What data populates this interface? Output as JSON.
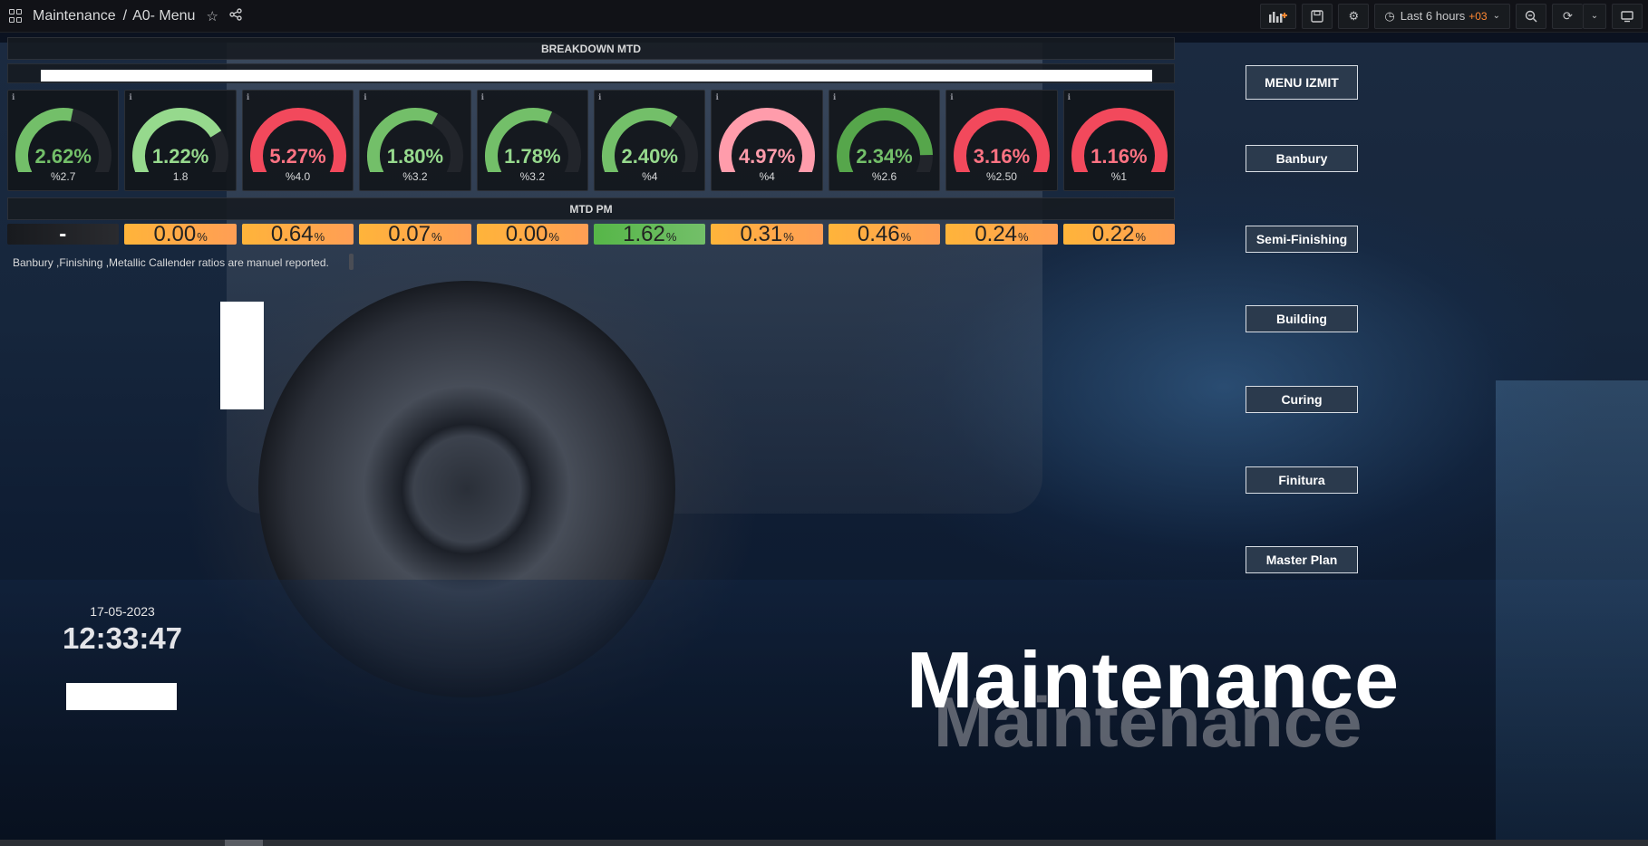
{
  "topbar": {
    "folder": "Maintenance",
    "separator": "/",
    "dashboard": "A0- Menu",
    "time_range": "Last 6 hours",
    "timezone": "+03"
  },
  "rows": {
    "breakdown": "BREAKDOWN MTD",
    "pm": "MTD PM"
  },
  "colors": {
    "green": "#73bf69",
    "dark_green": "#56a64b",
    "red": "#f2495c",
    "light_red": "#ff7383",
    "orange": "#ff9830",
    "track": "#22252b"
  },
  "gauges": [
    {
      "value": "2.62%",
      "label": "%2.7",
      "fill": 0.55,
      "color": "#73bf69",
      "text_color": "#73bf69"
    },
    {
      "value": "1.22%",
      "label": "1.8",
      "fill": 0.75,
      "color": "#96d98d",
      "text_color": "#96d98d"
    },
    {
      "value": "5.27%",
      "label": "%4.0",
      "fill": 1.0,
      "color": "#f2495c",
      "text_color": "#ff7383"
    },
    {
      "value": "1.80%",
      "label": "%3.2",
      "fill": 0.62,
      "color": "#73bf69",
      "text_color": "#96d98d"
    },
    {
      "value": "1.78%",
      "label": "%3.2",
      "fill": 0.6,
      "color": "#73bf69",
      "text_color": "#96d98d"
    },
    {
      "value": "2.40%",
      "label": "%4",
      "fill": 0.65,
      "color": "#73bf69",
      "text_color": "#96d98d"
    },
    {
      "value": "4.97%",
      "label": "%4",
      "fill": 1.0,
      "color": "#ff9cab",
      "text_color": "#ff9cab"
    },
    {
      "value": "2.34%",
      "label": "%2.6",
      "fill": 0.88,
      "color": "#56a64b",
      "text_color": "#73bf69"
    },
    {
      "value": "3.16%",
      "label": "%2.50",
      "fill": 1.0,
      "color": "#f2495c",
      "text_color": "#ff7383"
    },
    {
      "value": "1.16%",
      "label": "%1",
      "fill": 1.0,
      "color": "#f2495c",
      "text_color": "#ff7383"
    }
  ],
  "stats": [
    {
      "value": "-",
      "unit": "",
      "style": "dark"
    },
    {
      "value": "0.00",
      "unit": "%",
      "style": "orange"
    },
    {
      "value": "0.64",
      "unit": "%",
      "style": "orange"
    },
    {
      "value": "0.07",
      "unit": "%",
      "style": "orange"
    },
    {
      "value": "0.00",
      "unit": "%",
      "style": "orange"
    },
    {
      "value": "1.62",
      "unit": "%",
      "style": "green"
    },
    {
      "value": "0.31",
      "unit": "%",
      "style": "orange"
    },
    {
      "value": "0.46",
      "unit": "%",
      "style": "orange"
    },
    {
      "value": "0.24",
      "unit": "%",
      "style": "orange"
    },
    {
      "value": "0.22",
      "unit": "%",
      "style": "orange"
    }
  ],
  "note": "Banbury ,Finishing ,Metallic Callender ratios are manuel reported.",
  "clock": {
    "date": "17-05-2023",
    "time": "12:33:47"
  },
  "nav": [
    {
      "label": "MENU IZMIT"
    },
    {
      "label": "Banbury"
    },
    {
      "label": "Semi-Finishing"
    },
    {
      "label": "Building"
    },
    {
      "label": "Curing"
    },
    {
      "label": "Finitura"
    },
    {
      "label": "Master Plan"
    }
  ],
  "big_title": "Maintenance"
}
